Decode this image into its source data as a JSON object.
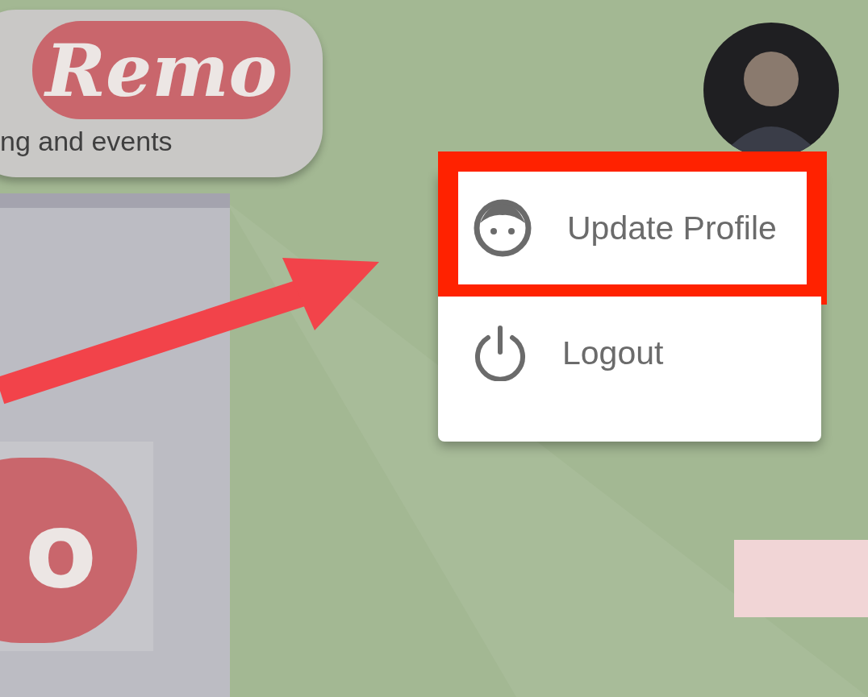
{
  "header_logo": {
    "text": "Remo",
    "tagline": "ng and events"
  },
  "side_logo": {
    "text": "o"
  },
  "menu": {
    "items": [
      {
        "label": "Update Profile",
        "kind": "profile",
        "highlighted": true
      },
      {
        "label": "Logout",
        "kind": "logout",
        "highlighted": false
      }
    ]
  }
}
